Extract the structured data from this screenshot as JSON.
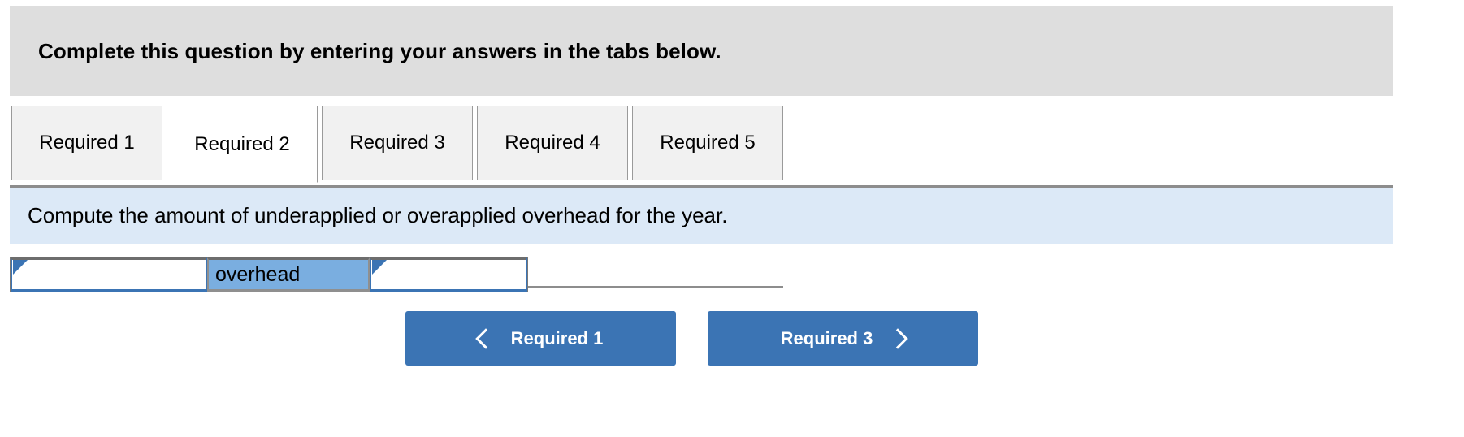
{
  "header": {
    "title": "Complete this question by entering your answers in the tabs below."
  },
  "tabs": {
    "active_index": 1,
    "items": [
      {
        "label": "Required 1"
      },
      {
        "label": "Required 2"
      },
      {
        "label": "Required 3"
      },
      {
        "label": "Required 4"
      },
      {
        "label": "Required 5"
      }
    ]
  },
  "instruction": {
    "text": "Compute the amount of underapplied or overapplied overhead for the year."
  },
  "answer_row": {
    "input_1": {
      "value": "",
      "placeholder": ""
    },
    "label": "overhead",
    "input_2": {
      "value": "",
      "placeholder": ""
    }
  },
  "navigation": {
    "prev_label": "Required 1",
    "next_label": "Required 3",
    "prev_icon": "chevron-left-icon",
    "next_icon": "chevron-right-icon"
  },
  "colors": {
    "header_bg": "#dedede",
    "instruction_bg": "#dce9f7",
    "tab_bg": "#f1f1f1",
    "tab_active_bg": "#ffffff",
    "accent_blue": "#3b74b4",
    "label_cell_bg": "#7aaee0",
    "border_gray": "#8d8d8d"
  }
}
